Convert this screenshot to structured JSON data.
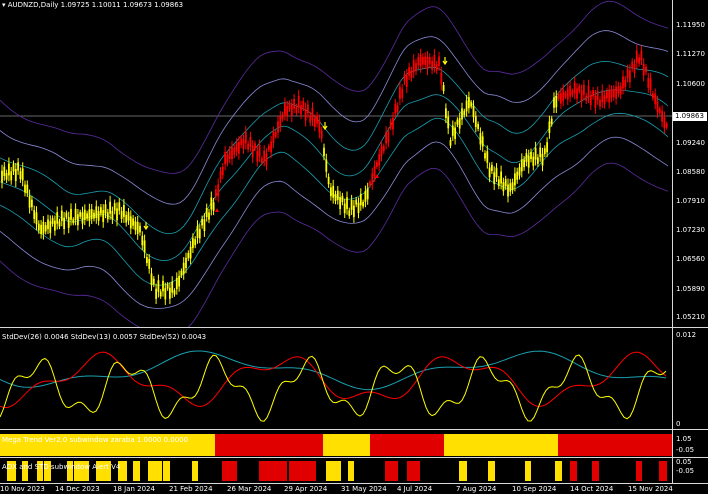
{
  "main_chart": {
    "title": "AUDNZD,Daily  1.09725 1.10011 1.09673 1.09863",
    "current_price": "1.09863",
    "price_axis": [
      "1.11950",
      "1.11270",
      "1.10600",
      "1.09240",
      "1.08580",
      "1.07910",
      "1.07230",
      "1.06560",
      "1.05890",
      "1.05210"
    ],
    "colors": {
      "bull": "#ffff00",
      "bear": "#ff0000",
      "band_outer": "#5b2ca0",
      "band_mid": "#8a8ad8",
      "band_inner": "#1a9fb0",
      "arrow": "#ffff00"
    }
  },
  "stddev_panel": {
    "title": "StdDev(26) 0.0046  StdDev(13) 0.0057  StdDev(52) 0.0043",
    "axis_top": "0.012",
    "axis_bottom": "0",
    "colors": {
      "sd26": "#ff0000",
      "sd13": "#ffff00",
      "sd52": "#1a9fb0"
    }
  },
  "mega_trend_panel": {
    "title": "Mega Trend Ver2.0 subwindow zaraba 1.0000 0.0000",
    "axis_top": "1.05",
    "axis_bottom": "-0.05",
    "segments": [
      {
        "from": 0.0,
        "to": 0.32,
        "color": "#ffe000"
      },
      {
        "from": 0.32,
        "to": 0.48,
        "color": "#e00000"
      },
      {
        "from": 0.48,
        "to": 0.55,
        "color": "#ffe000"
      },
      {
        "from": 0.55,
        "to": 0.66,
        "color": "#e00000"
      },
      {
        "from": 0.66,
        "to": 0.83,
        "color": "#ffe000"
      },
      {
        "from": 0.83,
        "to": 1.0,
        "color": "#e00000"
      }
    ]
  },
  "adx_panel": {
    "title": "ADX and STD subwindow Alert V4",
    "axis_top": "0.05",
    "axis_bottom": "-0.05"
  },
  "time_axis": [
    "10 Nov 2023",
    "14 Dec 2023",
    "18 Jan 2024",
    "21 Feb 2024",
    "26 Mar 2024",
    "29 Apr 2024",
    "31 May 2024",
    "4 Jul 2024",
    "7 Aug 2024",
    "10 Sep 2024",
    "14 Oct 2024",
    "15 Nov 2024"
  ]
}
